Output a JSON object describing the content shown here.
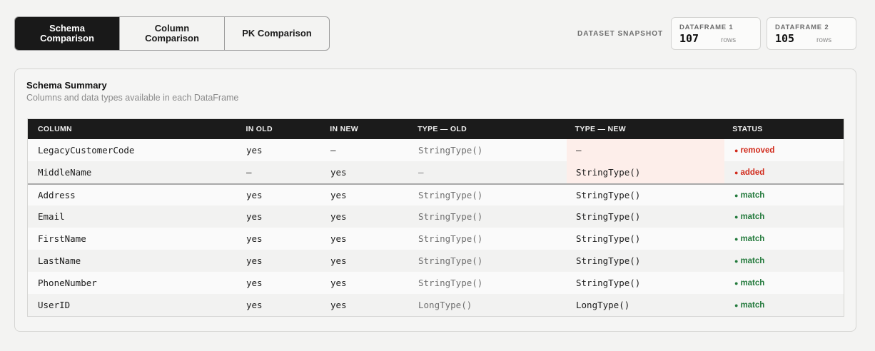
{
  "tabs": [
    {
      "label": "Schema\nComparison",
      "active": true
    },
    {
      "label": "Column\nComparison",
      "active": false
    },
    {
      "label": "PK Comparison",
      "active": false
    }
  ],
  "snapshot": {
    "label": "DATASET SNAPSHOT",
    "cards": [
      {
        "caption": "DATAFRAME 1",
        "value": "107",
        "unit": "rows"
      },
      {
        "caption": "DATAFRAME 2",
        "value": "105",
        "unit": "rows"
      }
    ]
  },
  "panel": {
    "title": "Schema Summary",
    "subtitle": "Columns and data types available in each DataFrame"
  },
  "table": {
    "headers": [
      "COLUMN",
      "IN OLD",
      "IN NEW",
      "TYPE — OLD",
      "TYPE — NEW",
      "STATUS"
    ],
    "rows": [
      {
        "column": "LegacyCustomerCode",
        "in_old": "yes",
        "in_new": "—",
        "type_old": "StringType()",
        "type_new": "—",
        "status": "removed"
      },
      {
        "column": "MiddleName",
        "in_old": "—",
        "in_new": "yes",
        "type_old": "—",
        "type_new": "StringType()",
        "status": "added"
      },
      {
        "column": "Address",
        "in_old": "yes",
        "in_new": "yes",
        "type_old": "StringType()",
        "type_new": "StringType()",
        "status": "match"
      },
      {
        "column": "Email",
        "in_old": "yes",
        "in_new": "yes",
        "type_old": "StringType()",
        "type_new": "StringType()",
        "status": "match"
      },
      {
        "column": "FirstName",
        "in_old": "yes",
        "in_new": "yes",
        "type_old": "StringType()",
        "type_new": "StringType()",
        "status": "match"
      },
      {
        "column": "LastName",
        "in_old": "yes",
        "in_new": "yes",
        "type_old": "StringType()",
        "type_new": "StringType()",
        "status": "match"
      },
      {
        "column": "PhoneNumber",
        "in_old": "yes",
        "in_new": "yes",
        "type_old": "StringType()",
        "type_new": "StringType()",
        "status": "match"
      },
      {
        "column": "UserID",
        "in_old": "yes",
        "in_new": "yes",
        "type_old": "LongType()",
        "type_new": "LongType()",
        "status": "match"
      }
    ]
  },
  "colors": {
    "dark": "#191919",
    "removed": "#d12a1b",
    "added": "#d12a1b",
    "match": "#237a3c",
    "highlight": "#fdeeea"
  }
}
